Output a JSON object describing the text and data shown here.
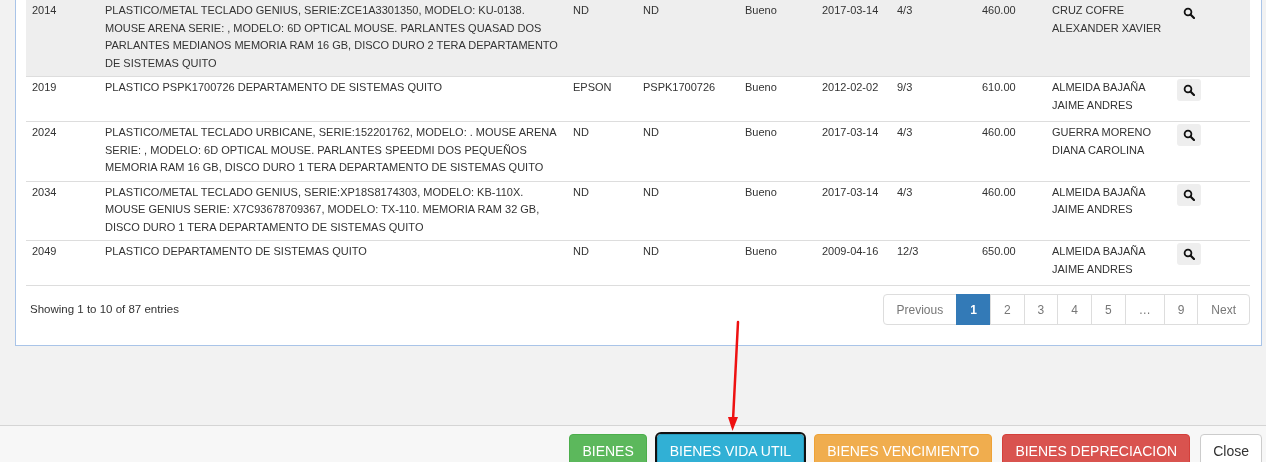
{
  "table": {
    "rows": [
      {
        "highlighted": true,
        "cells": [
          "2014",
          "PLASTICO/METAL TECLADO GENIUS, SERIE:ZCE1A3301350, MODELO: KU-0138. MOUSE ARENA SERIE: , MODELO: 6D OPTICAL MOUSE. PARLANTES QUASAD DOS PARLANTES MEDIANOS MEMORIA RAM 16 GB, DISCO DURO 2 TERA DEPARTAMENTO DE SISTEMAS QUITO",
          "ND",
          "ND",
          "Bueno",
          "2017-03-14",
          "4/3",
          "460.00",
          "CRUZ COFRE ALEXANDER XAVIER"
        ]
      },
      {
        "highlighted": false,
        "cells": [
          "2019",
          "PLASTICO PSPK1700726 DEPARTAMENTO DE SISTEMAS QUITO",
          "EPSON",
          "PSPK1700726",
          "Bueno",
          "2012-02-02",
          "9/3",
          "610.00",
          "ALMEIDA BAJAÑA JAIME ANDRES"
        ]
      },
      {
        "highlighted": false,
        "cells": [
          "2024",
          "PLASTICO/METAL TECLADO URBICANE, SERIE:152201762, MODELO: . MOUSE ARENA SERIE: , MODELO: 6D OPTICAL MOUSE. PARLANTES SPEEDMI DOS PEQUEÑOS MEMORIA RAM 16 GB, DISCO DURO 1 TERA DEPARTAMENTO DE SISTEMAS QUITO",
          "ND",
          "ND",
          "Bueno",
          "2017-03-14",
          "4/3",
          "460.00",
          "GUERRA MORENO DIANA CAROLINA"
        ]
      },
      {
        "highlighted": false,
        "cells": [
          "2034",
          "PLASTICO/METAL TECLADO GENIUS, SERIE:XP18S8174303, MODELO: KB-110X. MOUSE GENIUS SERIE: X7C93678709367, MODELO: TX-110. MEMORIA RAM 32 GB, DISCO DURO 1 TERA DEPARTAMENTO DE SISTEMAS QUITO",
          "ND",
          "ND",
          "Bueno",
          "2017-03-14",
          "4/3",
          "460.00",
          "ALMEIDA BAJAÑA JAIME ANDRES"
        ]
      },
      {
        "highlighted": false,
        "cells": [
          "2049",
          "PLASTICO DEPARTAMENTO DE SISTEMAS QUITO",
          "ND",
          "ND",
          "Bueno",
          "2009-04-16",
          "12/3",
          "650.00",
          "ALMEIDA BAJAÑA JAIME ANDRES"
        ]
      }
    ]
  },
  "info": "Showing 1 to 10 of 87 entries",
  "pagination": [
    {
      "label": "Previous",
      "selected": false
    },
    {
      "label": "1",
      "selected": true
    },
    {
      "label": "2",
      "selected": false
    },
    {
      "label": "3",
      "selected": false
    },
    {
      "label": "4",
      "selected": false
    },
    {
      "label": "5",
      "selected": false
    },
    {
      "label": "…",
      "selected": false
    },
    {
      "label": "9",
      "selected": false
    },
    {
      "label": "Next",
      "selected": false
    }
  ],
  "footer_buttons": [
    {
      "label": "BIENES",
      "kind": "success",
      "focused": false
    },
    {
      "label": "BIENES VIDA UTIL",
      "kind": "info",
      "focused": true
    },
    {
      "label": "BIENES VENCIMIENTO",
      "kind": "warning",
      "focused": false
    },
    {
      "label": "BIENES DEPRECIACION",
      "kind": "danger",
      "focused": false
    },
    {
      "label": "Close",
      "kind": "default",
      "focused": false
    }
  ]
}
